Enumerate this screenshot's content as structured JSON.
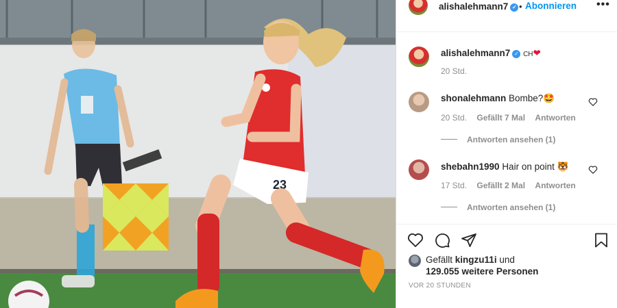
{
  "header": {
    "username": "alishalehmann7",
    "dot": "•",
    "follow_label": "Abonnieren",
    "more_label": "•••"
  },
  "caption": {
    "username": "alishalehmann7",
    "text": "CH",
    "emoji": "❤",
    "time": "20 Std."
  },
  "comments": [
    {
      "username": "shonalehmann",
      "text": "Bombe?",
      "emoji": "🤩",
      "time": "20 Std.",
      "likes": "Gefällt 7 Mal",
      "reply": "Antworten",
      "view_replies": "Antworten ansehen (1)"
    },
    {
      "username": "shebahn1990",
      "text": "Hair on point",
      "emoji": "🐯",
      "time": "17 Std.",
      "likes": "Gefällt 2 Mal",
      "reply": "Antworten",
      "view_replies": "Antworten ansehen (1)"
    }
  ],
  "likes": {
    "prefix": "Gefällt",
    "user": "kingzu11i",
    "suffix": "und",
    "others": "129.055 weitere Personen"
  },
  "timestamp": "VOR 20 STUNDEN",
  "icons": {
    "heart": "heart-icon",
    "comment": "comment-icon",
    "share": "share-icon",
    "save": "bookmark-icon",
    "verified": "verified-badge-icon",
    "jersey_number": "23"
  },
  "colors": {
    "accent": "#0095f6",
    "verified": "#3897f0",
    "muted": "#8e8e8e",
    "text": "#262626"
  }
}
